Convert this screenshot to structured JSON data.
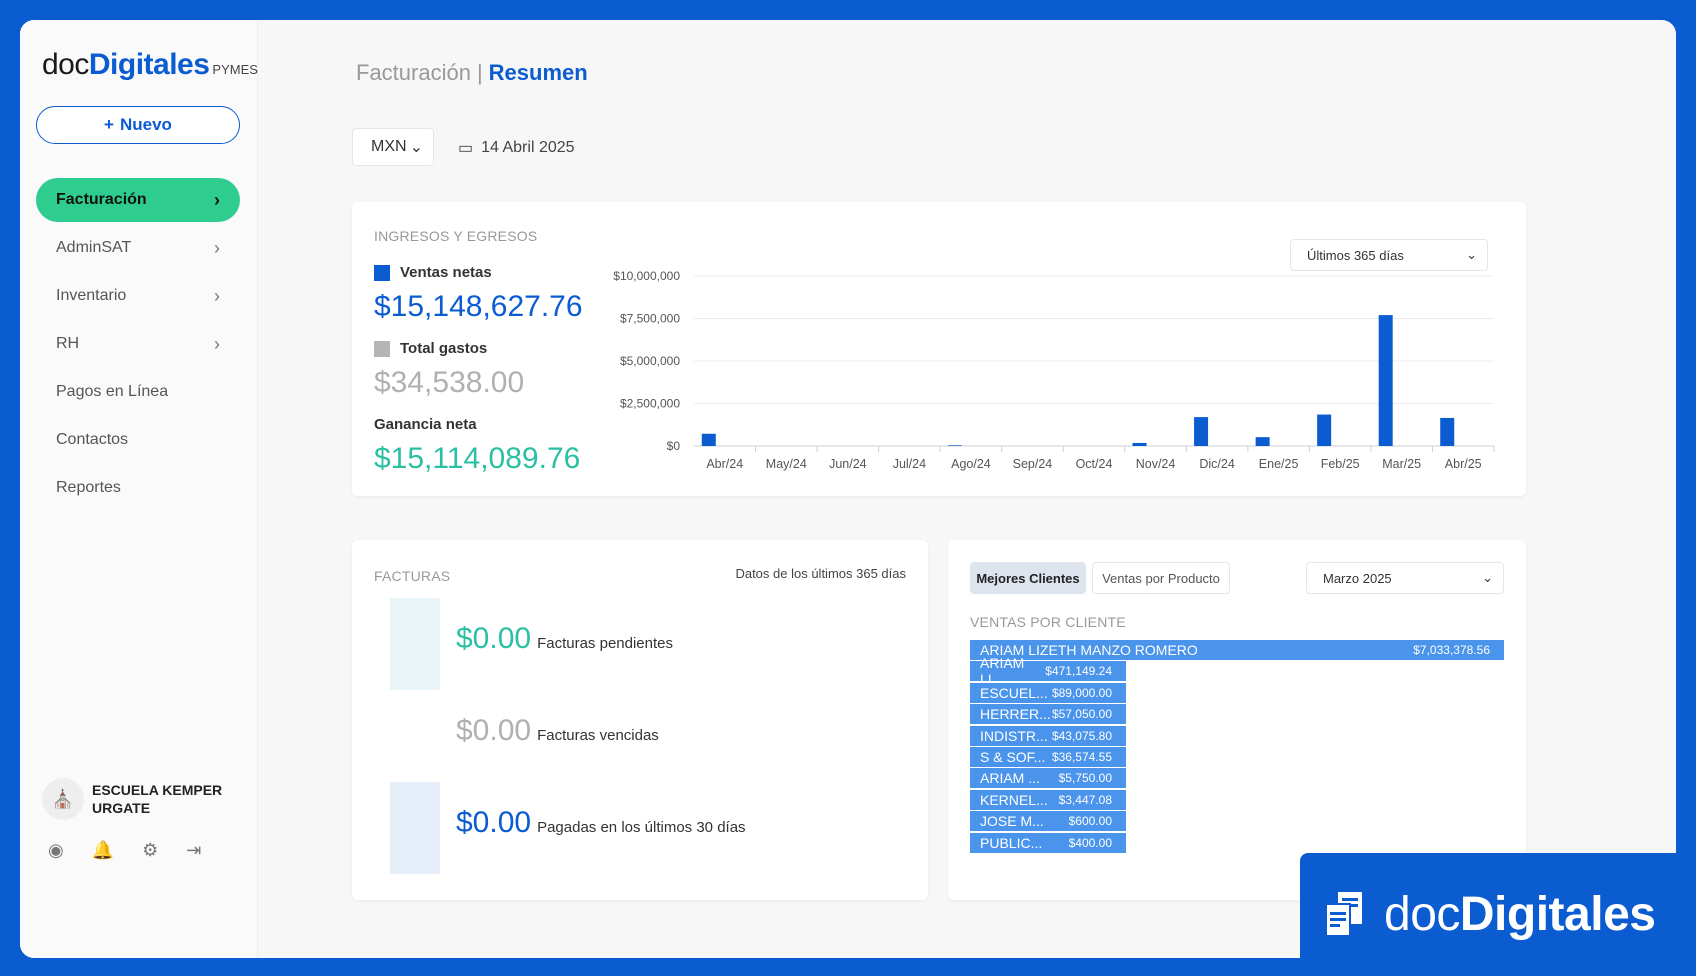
{
  "logo": {
    "doc": "doc",
    "digitales": "Digitales",
    "pymes": "PYMES"
  },
  "new_button": "Nuevo",
  "nav": [
    {
      "label": "Facturación",
      "chevron": true
    },
    {
      "label": "AdminSAT",
      "chevron": true
    },
    {
      "label": "Inventario",
      "chevron": true
    },
    {
      "label": "RH",
      "chevron": true
    },
    {
      "label": "Pagos en Línea",
      "chevron": false
    },
    {
      "label": "Contactos",
      "chevron": false
    },
    {
      "label": "Reportes",
      "chevron": false
    }
  ],
  "org_name": "ESCUELA KEMPER URGATE",
  "breadcrumb": {
    "section": "Facturación",
    "separator": "|",
    "page": "Resumen"
  },
  "currency": "MXN",
  "date": "14 Abril 2025",
  "summary": {
    "title": "INGRESOS Y EGRESOS",
    "ventas_label": "Ventas netas",
    "ventas_value": "$15,148,627.76",
    "gastos_label": "Total gastos",
    "gastos_value": "$34,538.00",
    "ganancia_label": "Ganancia neta",
    "ganancia_value": "$15,114,089.76",
    "range": "Últimos 365 días"
  },
  "colors": {
    "primary": "#0b5bd1",
    "accent_green": "#2ecc8f",
    "teal": "#2bbfa4",
    "gray": "#b5b5b5",
    "client_bar": "#4a94ec"
  },
  "chart_data": {
    "type": "bar",
    "categories": [
      "Abr/24",
      "May/24",
      "Jun/24",
      "Jul/24",
      "Ago/24",
      "Sep/24",
      "Oct/24",
      "Nov/24",
      "Dic/24",
      "Ene/25",
      "Feb/25",
      "Mar/25",
      "Abr/25"
    ],
    "series": [
      {
        "name": "Ventas netas",
        "values": [
          720000,
          0,
          0,
          0,
          40000,
          0,
          0,
          180000,
          1700000,
          520000,
          1850000,
          7700000,
          1650000
        ]
      }
    ],
    "yticks": [
      "$0",
      "$2,500,000",
      "$5,000,000",
      "$7,500,000",
      "$10,000,000"
    ],
    "ylim": [
      0,
      10000000
    ],
    "grid": true
  },
  "facturas": {
    "title": "FACTURAS",
    "note": "Datos de los últimos 365 días",
    "pendientes_value": "$0.00",
    "pendientes_label": "Facturas pendientes",
    "vencidas_value": "$0.00",
    "vencidas_label": "Facturas vencidas",
    "pagadas_value": "$0.00",
    "pagadas_label": "Pagadas en los últimos 30 días"
  },
  "clientes": {
    "tab_mejores": "Mejores Clientes",
    "tab_productos": "Ventas por Producto",
    "month": "Marzo 2025",
    "title": "VENTAS POR CLIENTE",
    "rows": [
      {
        "name": "ARIAM LIZETH MANZO ROMERO",
        "value": "$7,033,378.56",
        "amount": 7033378.56
      },
      {
        "name": "ARIAM LI...",
        "value": "$471,149.24",
        "amount": 471149.24
      },
      {
        "name": "ESCUEL...",
        "value": "$89,000.00",
        "amount": 89000
      },
      {
        "name": "HERRER...",
        "value": "$57,050.00",
        "amount": 57050
      },
      {
        "name": "INDISTR...",
        "value": "$43,075.80",
        "amount": 43075.8
      },
      {
        "name": "S & SOF...",
        "value": "$36,574.55",
        "amount": 36574.55
      },
      {
        "name": "ARIAM ...",
        "value": "$5,750.00",
        "amount": 5750
      },
      {
        "name": "KERNEL...",
        "value": "$3,447.08",
        "amount": 3447.08
      },
      {
        "name": "JOSE M...",
        "value": "$600.00",
        "amount": 600
      },
      {
        "name": "PUBLIC...",
        "value": "$400.00",
        "amount": 400
      }
    ]
  },
  "promo": {
    "doc": "doc",
    "digitales": "Digitales"
  }
}
